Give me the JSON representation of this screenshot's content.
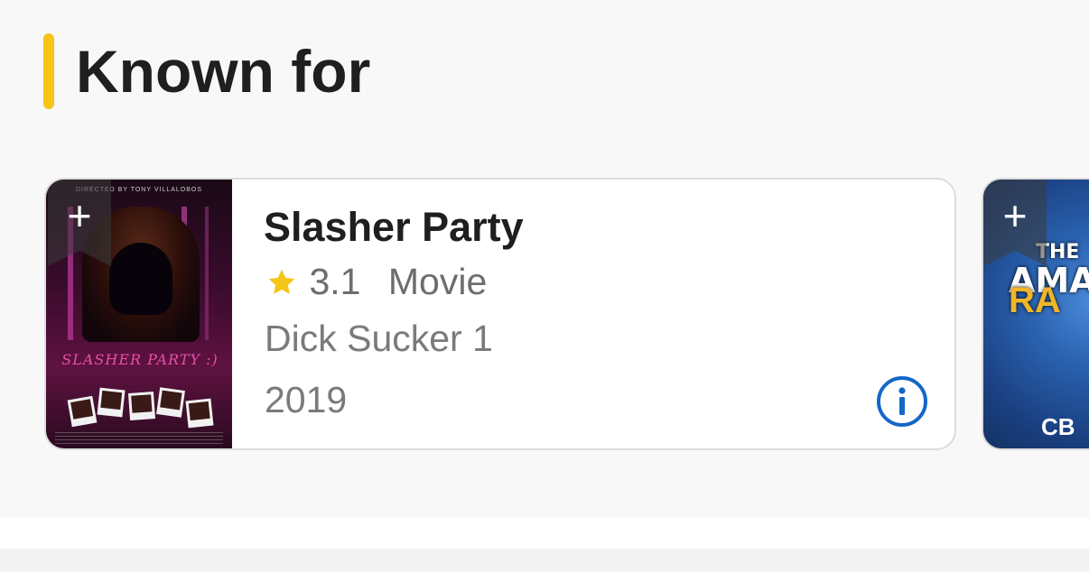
{
  "section": {
    "title": "Known for",
    "accent_color": "#f5c518"
  },
  "known_for": [
    {
      "title": "Slasher Party",
      "rating": "3.1",
      "type": "Movie",
      "character": "Dick Sucker 1",
      "year": "2019",
      "add_icon": "plus-icon",
      "info_icon": "info-icon",
      "poster": {
        "director_credit": "DIRECTED BY TONY VILLALOBOS",
        "title_art": "SLASHER PARTY :)"
      }
    },
    {
      "poster": {
        "title_art_line1": "THE",
        "title_art_line2": "AMAZ",
        "title_art_line3": "RA",
        "network": "CB"
      },
      "add_icon": "plus-icon"
    }
  ],
  "colors": {
    "star": "#f5c518",
    "info": "#1367c9"
  }
}
